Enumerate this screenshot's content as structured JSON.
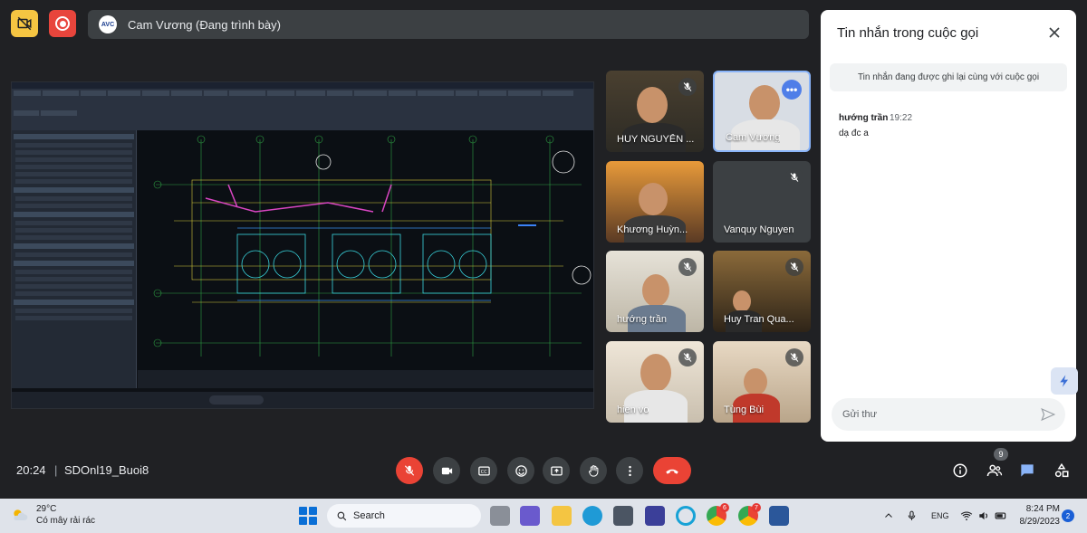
{
  "presenter": {
    "avatar_text": "AVC",
    "label": "Cam Vương (Đang trình bày)"
  },
  "participants": [
    {
      "name": "HUY NGUYỄN ..."
    },
    {
      "name": "Cam Vương"
    },
    {
      "name": "Khương Huỳn..."
    },
    {
      "name": "Vanquy Nguyen"
    },
    {
      "name": "hướng trần"
    },
    {
      "name": "Huy Tran Qua..."
    },
    {
      "name": "hien vo"
    },
    {
      "name": "Tùng Bùi"
    }
  ],
  "chat": {
    "title": "Tin nhắn trong cuộc gọi",
    "notice": "Tin nhắn đang được ghi lại cùng với cuộc gọi",
    "messages": [
      {
        "sender": "hướng trần",
        "time": "19:22",
        "text": "dạ đc a"
      }
    ],
    "input_placeholder": "Gửi thư"
  },
  "meeting": {
    "time": "20:24",
    "separator": "|",
    "code": "SDOnl19_Buoi8",
    "people_count": "9"
  },
  "taskbar": {
    "weather_temp": "29°C",
    "weather_desc": "Có mây rải rác",
    "search_label": "Search",
    "language": "ENG",
    "clock_time": "8:24 PM",
    "clock_date": "8/29/2023",
    "notification_count": "2",
    "chrome_badge_1": "6",
    "chrome_badge_2": "7"
  },
  "colors": {
    "hangup": "#ea4335",
    "accent_blue": "#1a73e8",
    "tile_bg": "#3c4043"
  }
}
